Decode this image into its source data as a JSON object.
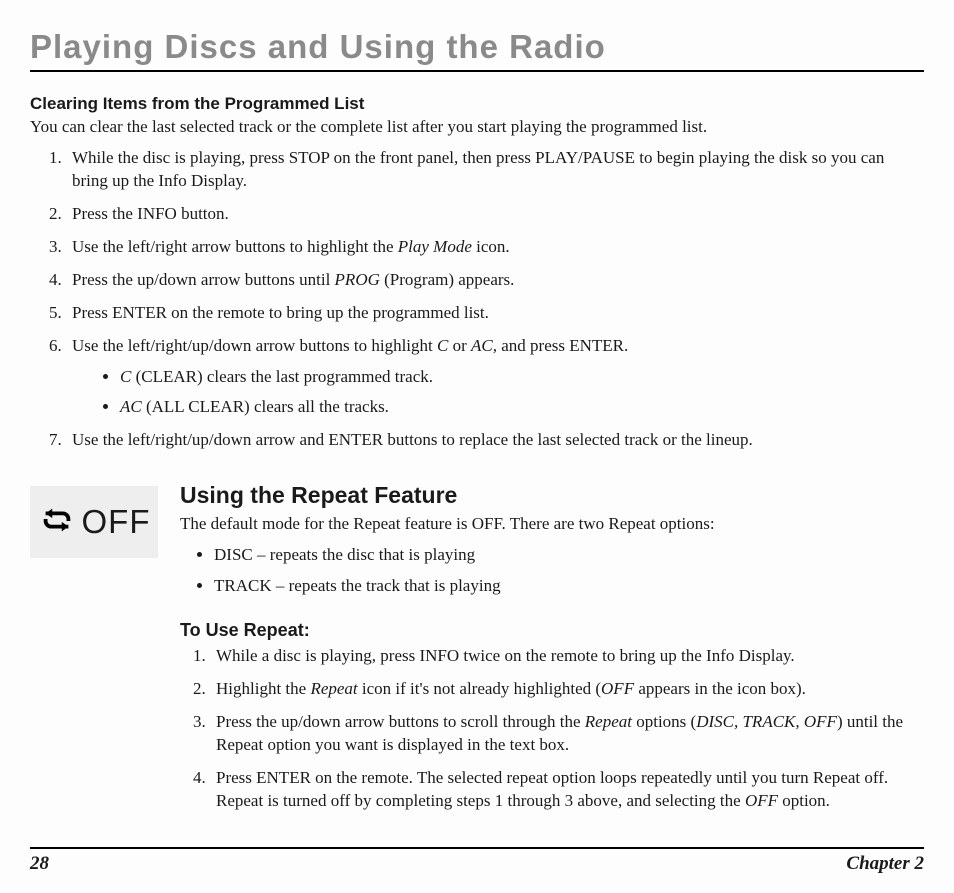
{
  "chapterTitle": "Playing Discs and Using the Radio",
  "section1": {
    "heading": "Clearing Items from the Programmed List",
    "intro": "You can clear the last selected track or the complete list after you start playing the programmed list.",
    "step1": "While the disc is playing, press STOP on the front panel, then press PLAY/PAUSE to begin playing the disk so you can bring up the Info Display.",
    "step2": "Press the INFO button.",
    "step3a": "Use the left/right arrow buttons to highlight the ",
    "step3b": "Play Mode",
    "step3c": " icon.",
    "step4a": "Press the up/down arrow buttons until ",
    "step4b": "PROG",
    "step4c": " (Program) appears.",
    "step5": "Press ENTER on the remote to bring up the programmed list.",
    "step6a": "Use the left/right/up/down arrow buttons to highlight ",
    "step6b": "C",
    "step6c": " or ",
    "step6d": "AC,",
    "step6e": " and press ENTER.",
    "sub1a": "C",
    "sub1b": " (CLEAR) clears the last programmed track.",
    "sub2a": "AC",
    "sub2b": " (ALL CLEAR) clears all the tracks.",
    "step7": "Use the left/right/up/down arrow and ENTER buttons to replace the last selected track or the lineup."
  },
  "repeat": {
    "iconLabel": "OFF",
    "heading": "Using the Repeat Feature",
    "intro": "The default mode for the Repeat feature is OFF. There are two Repeat options:",
    "opt1": "DISC – repeats the disc that is playing",
    "opt2": "TRACK – repeats the track that is playing",
    "subheading": "To Use Repeat:",
    "r1": "While a disc is playing, press INFO twice on the remote to bring up the Info Display.",
    "r2a": "Highlight the ",
    "r2b": "Repeat",
    "r2c": " icon if it's not already highlighted (",
    "r2d": "OFF",
    "r2e": " appears in the icon box).",
    "r3a": "Press the up/down arrow buttons to scroll through the ",
    "r3b": "Repeat",
    "r3c": " options (",
    "r3d": "DISC, TRACK, OFF",
    "r3e": ") until the Repeat option you want is displayed in the text box.",
    "r4a": "Press ENTER on the remote. The selected repeat option loops repeatedly until you turn Repeat off. Repeat is turned off by completing steps 1 through 3 above, and selecting the ",
    "r4b": "OFF",
    "r4c": " option."
  },
  "footer": {
    "page": "28",
    "chapter": "Chapter 2"
  }
}
